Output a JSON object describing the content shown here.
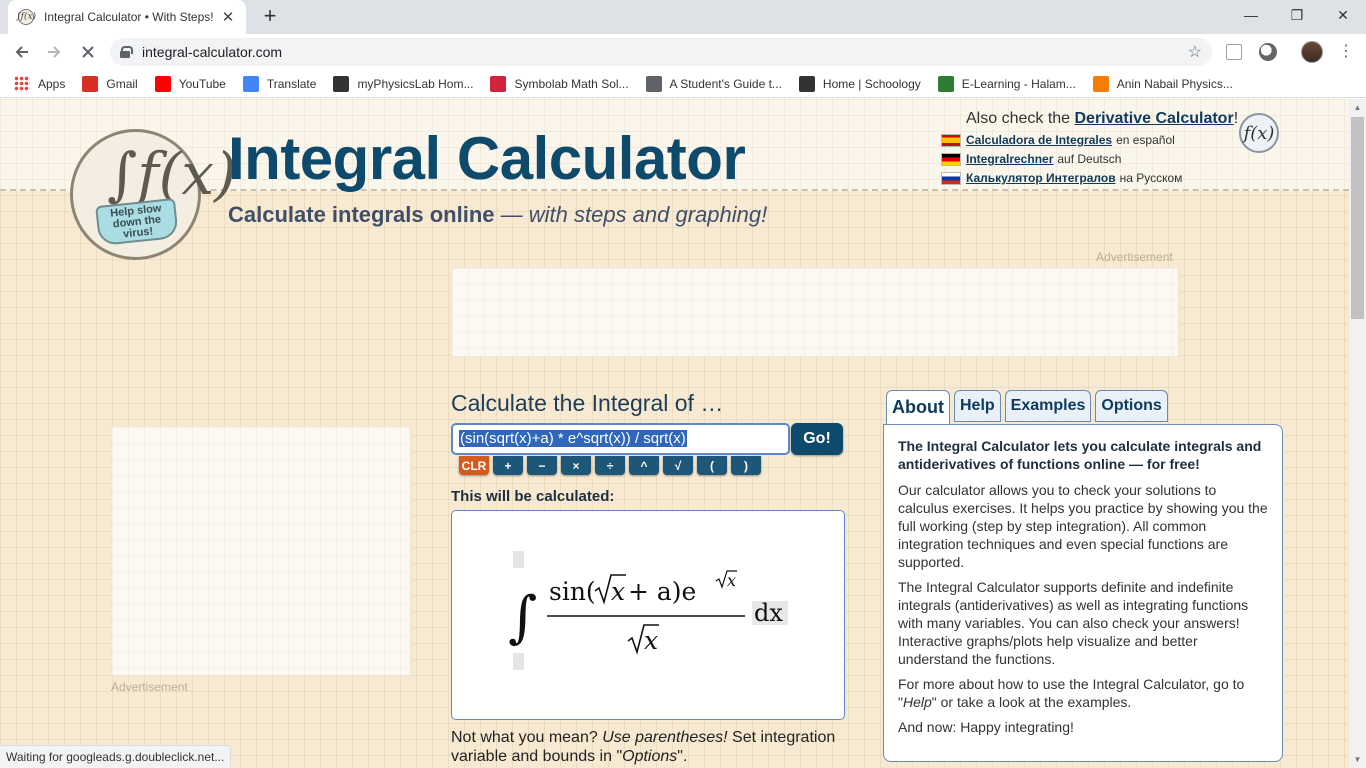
{
  "browser": {
    "tab_title": "Integral Calculator • With Steps!",
    "tab_favicon_text": "∫f(x)",
    "new_tab": "+",
    "close": "✕",
    "url": "integral-calculator.com",
    "window_controls": {
      "minimize": "—",
      "restore": "❐",
      "close": "✕"
    },
    "bookmarks": [
      {
        "label": "Apps",
        "icon": "apps-grid-icon",
        "color": "#4285f4"
      },
      {
        "label": "Gmail",
        "icon": "gmail-icon",
        "color": "#d93025"
      },
      {
        "label": "YouTube",
        "icon": "youtube-icon",
        "color": "#ff0000"
      },
      {
        "label": "Translate",
        "icon": "translate-icon",
        "color": "#4285f4"
      },
      {
        "label": "myPhysicsLab Hom...",
        "icon": "myphysicslab-icon",
        "color": "#333333"
      },
      {
        "label": "Symbolab Math Sol...",
        "icon": "symbolab-icon",
        "color": "#d2233c"
      },
      {
        "label": "A Student's Guide t...",
        "icon": "globe-icon",
        "color": "#5f6368"
      },
      {
        "label": "Home | Schoology",
        "icon": "schoology-icon",
        "color": "#333333"
      },
      {
        "label": "E-Learning - Halam...",
        "icon": "elearning-icon",
        "color": "#2e7d32"
      },
      {
        "label": "Anin Nabail Physics...",
        "icon": "blogger-icon",
        "color": "#f57d00"
      }
    ],
    "status": "Waiting for googleads.g.doubleclick.net..."
  },
  "header": {
    "logo_fx": "∫f(x)",
    "logo_mask_text": "Help slow down the virus!",
    "title": "Integral Calculator",
    "subtitle_bold": "Calculate integrals online",
    "subtitle_rest": " — with steps and graphing!",
    "also_prefix": "Also check the ",
    "also_link": "Derivative Calculator",
    "also_suffix": "!",
    "languages": [
      {
        "link": "Calculadora de Integrales",
        "rest": "en español"
      },
      {
        "link": "Integralrechner",
        "rest": "auf Deutsch"
      },
      {
        "link": "Калькулятор Интегралов",
        "rest": "на Русском"
      }
    ],
    "badge": "f(x)"
  },
  "ads": {
    "label": "Advertisement"
  },
  "calculator": {
    "heading": "Calculate the Integral of …",
    "input_value": "(sin(sqrt(x)+a) * e^sqrt(x)) / sqrt(x)",
    "go_label": "Go!",
    "keys": [
      "CLR",
      "+",
      "−",
      "×",
      "÷",
      "^",
      "√",
      "(",
      ")"
    ],
    "preview_label": "This will be calculated:",
    "preview_formula": {
      "integral": "∫",
      "numerator_sin": "sin(",
      "numerator_x": "x",
      "numerator_plus_a": " + a)e",
      "denominator_x": "x",
      "dx": "dx"
    },
    "hint_1": "Not what you mean? ",
    "hint_2": "Use parentheses!",
    "hint_3": " Set integration variable and bounds in \"",
    "hint_4": "Options",
    "hint_5": "\"."
  },
  "tabs": {
    "items": [
      "About",
      "Help",
      "Examples",
      "Options"
    ],
    "active": "About",
    "about": {
      "lead": "The Integral Calculator lets you calculate integrals and antiderivatives of functions online — for free!",
      "p1": "Our calculator allows you to check your solutions to calculus exercises. It helps you practice by showing you the full working (step by step integration). All common integration techniques and even special functions are supported.",
      "p2": "The Integral Calculator supports definite and indefinite integrals (antiderivatives) as well as integrating functions with many variables. You can also check your answers! Interactive graphs/plots help visualize and better understand the functions.",
      "p3a": "For more about how to use the Integral Calculator, go to \"",
      "p3b": "Help",
      "p3c": "\" or take a look at the examples.",
      "p4": "And now: Happy integrating!"
    }
  }
}
